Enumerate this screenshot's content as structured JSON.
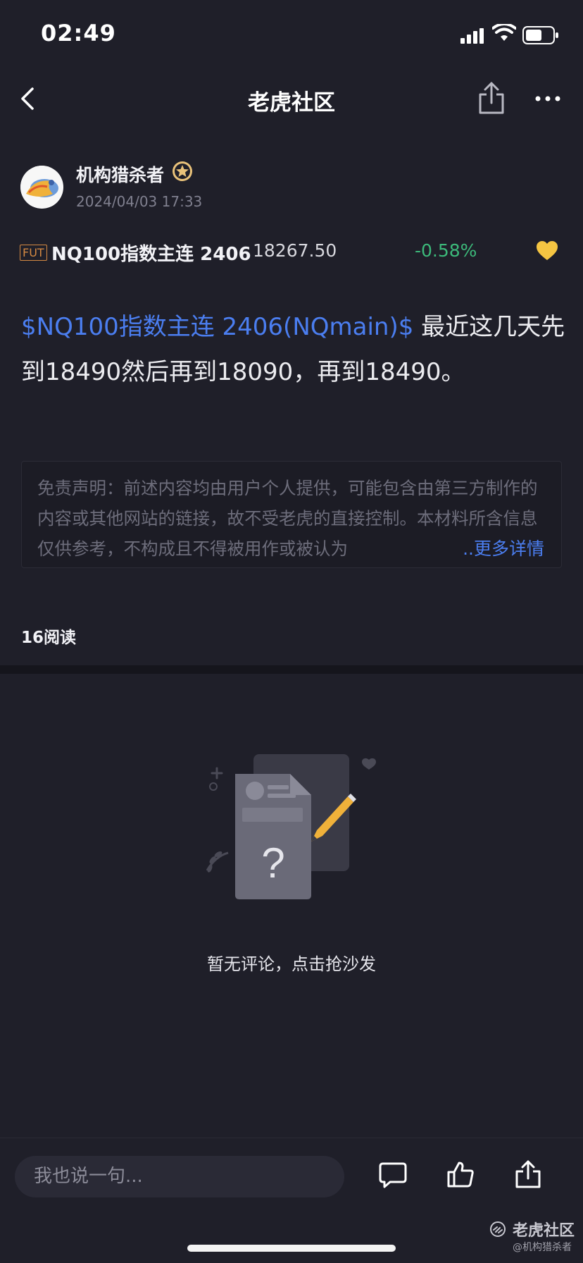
{
  "status_bar": {
    "time": "02:49"
  },
  "nav": {
    "title": "老虎社区"
  },
  "author": {
    "name": "机构猎杀者",
    "time": "2024/04/03 17:33"
  },
  "ticker": {
    "tag": "FUT",
    "name": "NQ100指数主连 2406",
    "price": "18267.50",
    "change": "-0.58%"
  },
  "post": {
    "link_text": "$NQ100指数主连 2406(NQmain)$",
    "text": " 最近这几天先到18490然后再到18090，再到18490。"
  },
  "disclaimer": {
    "text": "免责声明：前述内容均由用户个人提供，可能包含由第三方制作的内容或其他网站的链接，故不受老虎的直接控制。本材料所含信息仅供参考，不构成且不得被用作或被认为",
    "more": "..更多详情"
  },
  "read_count": "16阅读",
  "empty_state": {
    "text": "暂无评论，点击抢沙发"
  },
  "bottom_bar": {
    "input_placeholder": "我也说一句..."
  },
  "watermark": {
    "name": "老虎社区",
    "handle": "@机构猎杀者"
  },
  "icons": {
    "back": "chevron-left-icon",
    "share": "share-icon",
    "more": "more-dots-icon",
    "heart": "heart-icon",
    "comment": "comment-icon",
    "like": "thumbs-up-icon",
    "badge": "verified-badge-icon"
  },
  "colors": {
    "link": "#4b7ef0",
    "negative_change": "#3cb97a",
    "heart": "#f5c542",
    "background": "#1f1f29"
  }
}
